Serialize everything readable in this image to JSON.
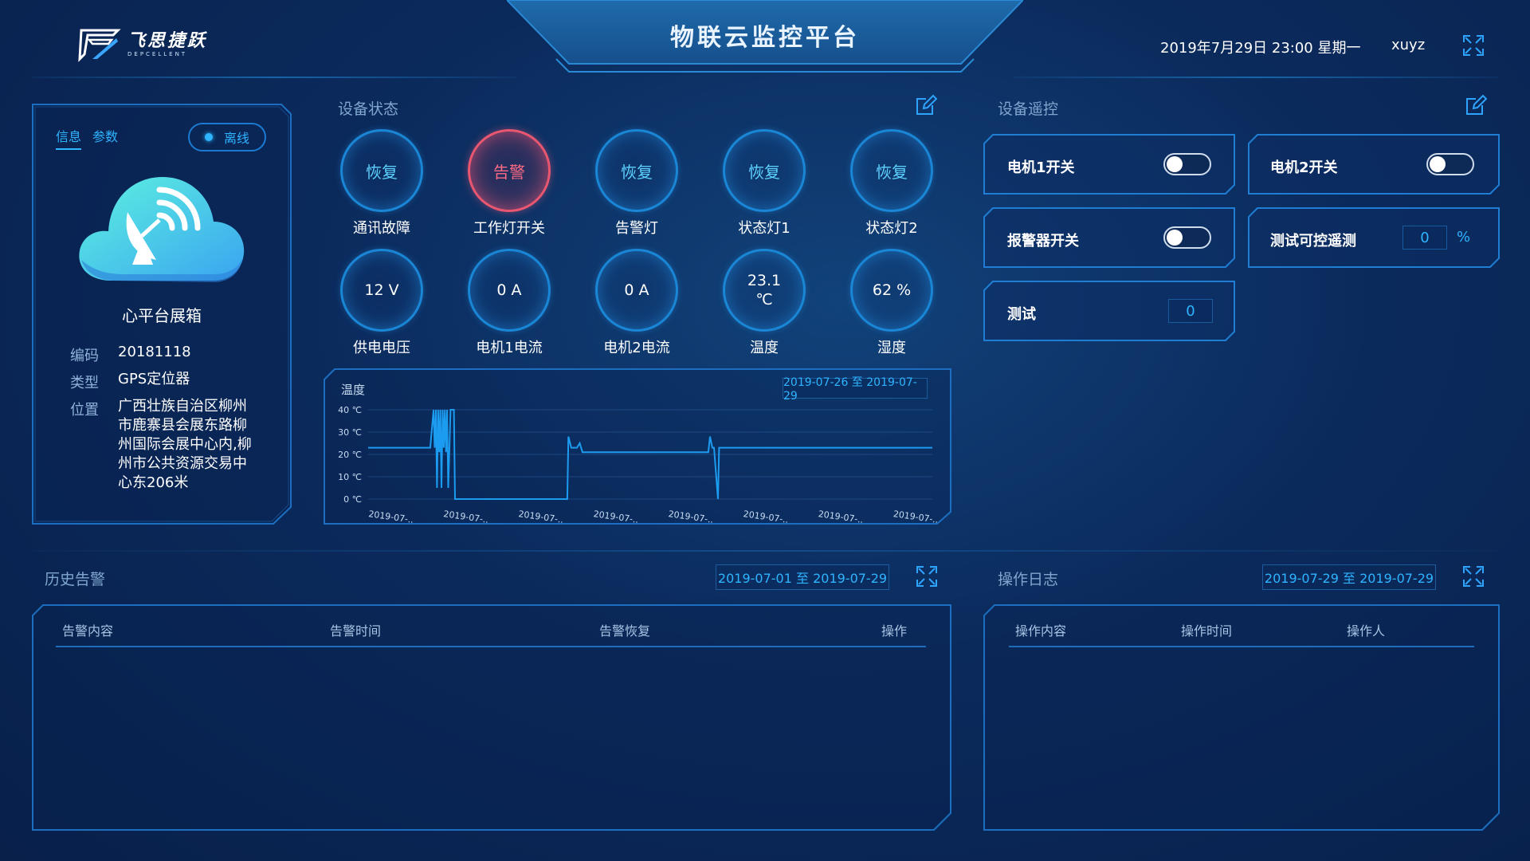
{
  "header": {
    "logo_cn": "飞思捷跃",
    "logo_en": "DEPCELLENT",
    "title": "物联云监控平台",
    "datetime": "2019年7月29日 23:00 星期一",
    "username": "xuyz"
  },
  "device_info": {
    "tabs": [
      "信息",
      "参数"
    ],
    "status": "离线",
    "name": "心平台展箱",
    "fields": [
      {
        "key": "编码",
        "value": "20181118"
      },
      {
        "key": "类型",
        "value": "GPS定位器"
      },
      {
        "key": "位置",
        "lines": [
          "广西壮族自治区柳州",
          "市鹿寨县会展东路柳",
          "州国际会展中心内,柳",
          "州市公共资源交易中",
          "心东206米"
        ]
      }
    ]
  },
  "device_status": {
    "title": "设备状态",
    "row1": [
      {
        "value": "恢复",
        "label": "通讯故障",
        "state": "normal"
      },
      {
        "value": "告警",
        "label": "工作灯开关",
        "state": "alarm"
      },
      {
        "value": "恢复",
        "label": "告警灯",
        "state": "normal"
      },
      {
        "value": "恢复",
        "label": "状态灯1",
        "state": "normal"
      },
      {
        "value": "恢复",
        "label": "状态灯2",
        "state": "normal"
      }
    ],
    "row2": [
      {
        "value": "12 V",
        "label": "供电电压"
      },
      {
        "value": "0 A",
        "label": "电机1电流"
      },
      {
        "value": "0 A",
        "label": "电机2电流"
      },
      {
        "value": "23.1",
        "unit": "℃",
        "label": "温度"
      },
      {
        "value": "62 %",
        "label": "湿度"
      }
    ]
  },
  "chart_data": {
    "type": "line",
    "title": "温度",
    "date_range": "2019-07-26 至 2019-07-29",
    "y_ticks": [
      "40 ℃",
      "30 ℃",
      "20 ℃",
      "10 ℃",
      "0 ℃"
    ],
    "x_ticks": [
      "2019-07-..",
      "2019-07-..",
      "2019-07-..",
      "2019-07-..",
      "2019-07-..",
      "2019-07-..",
      "2019-07-..",
      "2019-07-.."
    ],
    "ylim": [
      0,
      40
    ],
    "grid": true,
    "series": [
      {
        "x": [
          0,
          11,
          11.6,
          11.8,
          12.0,
          12.2,
          12.4,
          12.6,
          12.8,
          13.0,
          13.2,
          13.4,
          13.6,
          13.8,
          14.0,
          14.2,
          14.6,
          14.8,
          15.2,
          15.4,
          16,
          16.2,
          17,
          20,
          30,
          35,
          35.3,
          35.5,
          36,
          37,
          37.5,
          38,
          40,
          50,
          60,
          60.3,
          60.6,
          61,
          61.3,
          62,
          62.2,
          62.5,
          63,
          80,
          100
        ],
        "y": [
          23,
          23,
          40,
          23,
          40,
          5,
          40,
          21,
          40,
          5,
          40,
          23,
          40,
          21,
          40,
          5,
          40,
          40,
          40,
          0,
          0,
          0,
          0,
          0,
          0,
          0,
          0,
          28,
          23,
          23,
          25,
          21,
          21,
          21,
          21,
          21,
          28,
          23,
          23,
          0,
          23,
          23,
          23,
          23,
          23
        ]
      }
    ]
  },
  "remote": {
    "title": "设备遥控",
    "controls": [
      {
        "label": "电机1开关",
        "kind": "toggle"
      },
      {
        "label": "电机2开关",
        "kind": "toggle"
      },
      {
        "label": "报警器开关",
        "kind": "toggle"
      },
      {
        "label": "测试可控遥测",
        "kind": "number",
        "value": "0",
        "unit": "%"
      },
      {
        "label": "测试",
        "kind": "number",
        "value": "0"
      }
    ]
  },
  "alarm_history": {
    "title": "历史告警",
    "date_range": "2019-07-01 至 2019-07-29",
    "columns": [
      "告警内容",
      "告警时间",
      "告警恢复",
      "操作"
    ]
  },
  "operation_log": {
    "title": "操作日志",
    "date_range": "2019-07-29 至 2019-07-29",
    "columns": [
      "操作内容",
      "操作时间",
      "操作人"
    ]
  }
}
